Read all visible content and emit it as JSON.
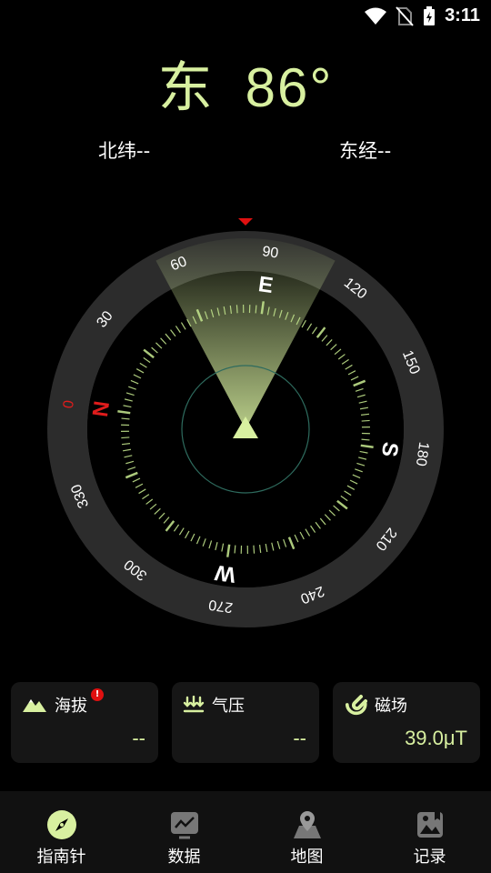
{
  "status": {
    "time": "3:11"
  },
  "heading": {
    "direction": "东",
    "degrees": "86°"
  },
  "coords": {
    "latitude": "北纬--",
    "longitude": "东经--"
  },
  "compass": {
    "cardinals": {
      "north": "N",
      "east": "E",
      "south": "S",
      "west": "W"
    },
    "ring_labels": [
      "0",
      "30",
      "60",
      "90",
      "120",
      "150",
      "180",
      "210",
      "240",
      "270",
      "300",
      "330"
    ],
    "heading_deg": 86,
    "colors": {
      "accent": "#d8f0a0",
      "north": "#e01c1c",
      "ring": "#2c2c2c",
      "tick": "#bfe08a"
    }
  },
  "cards": {
    "altitude": {
      "label": "海拔",
      "value": "--",
      "alert": "!"
    },
    "pressure": {
      "label": "气压",
      "value": "--"
    },
    "magnetic": {
      "label": "磁场",
      "value": "39.0μT"
    }
  },
  "nav": {
    "items": [
      {
        "label": "指南针",
        "icon": "compass-icon",
        "active": true
      },
      {
        "label": "数据",
        "icon": "chart-icon",
        "active": false
      },
      {
        "label": "地图",
        "icon": "map-pin-icon",
        "active": false
      },
      {
        "label": "记录",
        "icon": "image-record-icon",
        "active": false
      }
    ]
  }
}
